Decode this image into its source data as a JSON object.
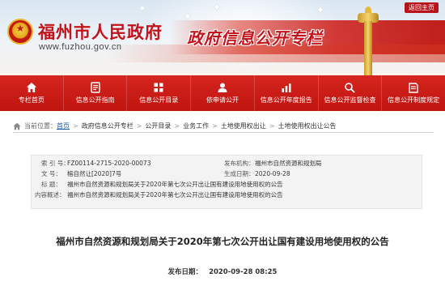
{
  "header": {
    "site_title": "福州市人民政府",
    "site_url": "www.fuzhou.gov.cn",
    "column_title": "政府信息公开专栏",
    "return_label": "返回主页"
  },
  "nav": {
    "items": [
      {
        "label": "专栏首页",
        "icon": "home-icon"
      },
      {
        "label": "信息公开指南",
        "icon": "guide-icon"
      },
      {
        "label": "信息公开目录",
        "icon": "catalog-icon"
      },
      {
        "label": "依申请公开",
        "icon": "application-icon"
      },
      {
        "label": "信息公开年度报告",
        "icon": "report-icon"
      },
      {
        "label": "信息公开监督检查",
        "icon": "inspection-icon"
      },
      {
        "label": "信息公开制度规定",
        "icon": "regulation-icon"
      }
    ]
  },
  "breadcrumb": {
    "prefix": "当前位置：",
    "items": [
      "首页",
      "政府信息公开专栏",
      "公开目录",
      "业务工作",
      "土地使用权出让",
      "土地使用权出让公告"
    ]
  },
  "meta": {
    "index_label": "索 引 号：",
    "index_value": "FZ00114-2715-2020-00073",
    "org_label": "发布机构：",
    "org_value": "福州市自然资源和规划局",
    "doc_label": "文    号：",
    "doc_value": "榕自然让[2020]7号",
    "date_label": "生成日期：",
    "date_value": "2020-09-28",
    "title_label": "标    题：",
    "title_value": "福州市自然资源和规划局关于2020年第七次公开出让国有建设用地使用权的公告",
    "summary_label": "内容概述：",
    "summary_value": "福州市自然资源和规划局关于2020年第七次公开出让国有建设用地使用权的公告"
  },
  "article": {
    "title": "福州市自然资源和规划局关于2020年第七次公开出让国有建设用地使用权的公告",
    "publish_label": "发布日期：",
    "publish_value": "2020-09-28 08:25"
  }
}
